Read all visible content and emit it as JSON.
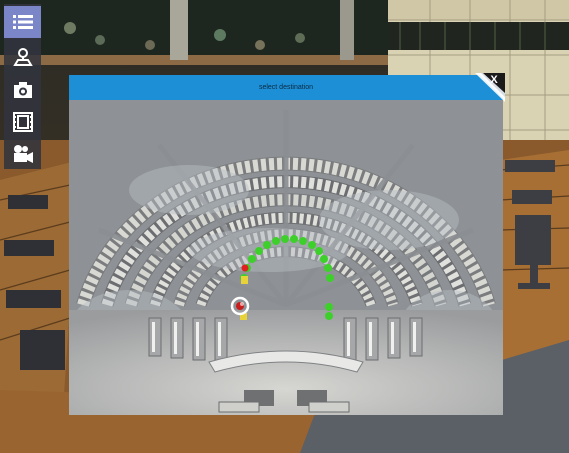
{
  "toolbar": {
    "items": [
      {
        "icon": "menu-list-icon",
        "active": true
      },
      {
        "icon": "map-pin-icon",
        "active": false
      },
      {
        "icon": "camera-icon",
        "active": false
      },
      {
        "icon": "film-strip-icon",
        "active": false
      },
      {
        "icon": "video-camera-icon",
        "active": false
      }
    ]
  },
  "dialog": {
    "title": "select destination",
    "close_label": "X"
  },
  "colors": {
    "header": "#1d8fd6",
    "available_seat": "#3ed02a",
    "selected_seat": "#e02020",
    "reserved_seat": "#e8d23a",
    "toolbar_active": "#7a86c8"
  }
}
